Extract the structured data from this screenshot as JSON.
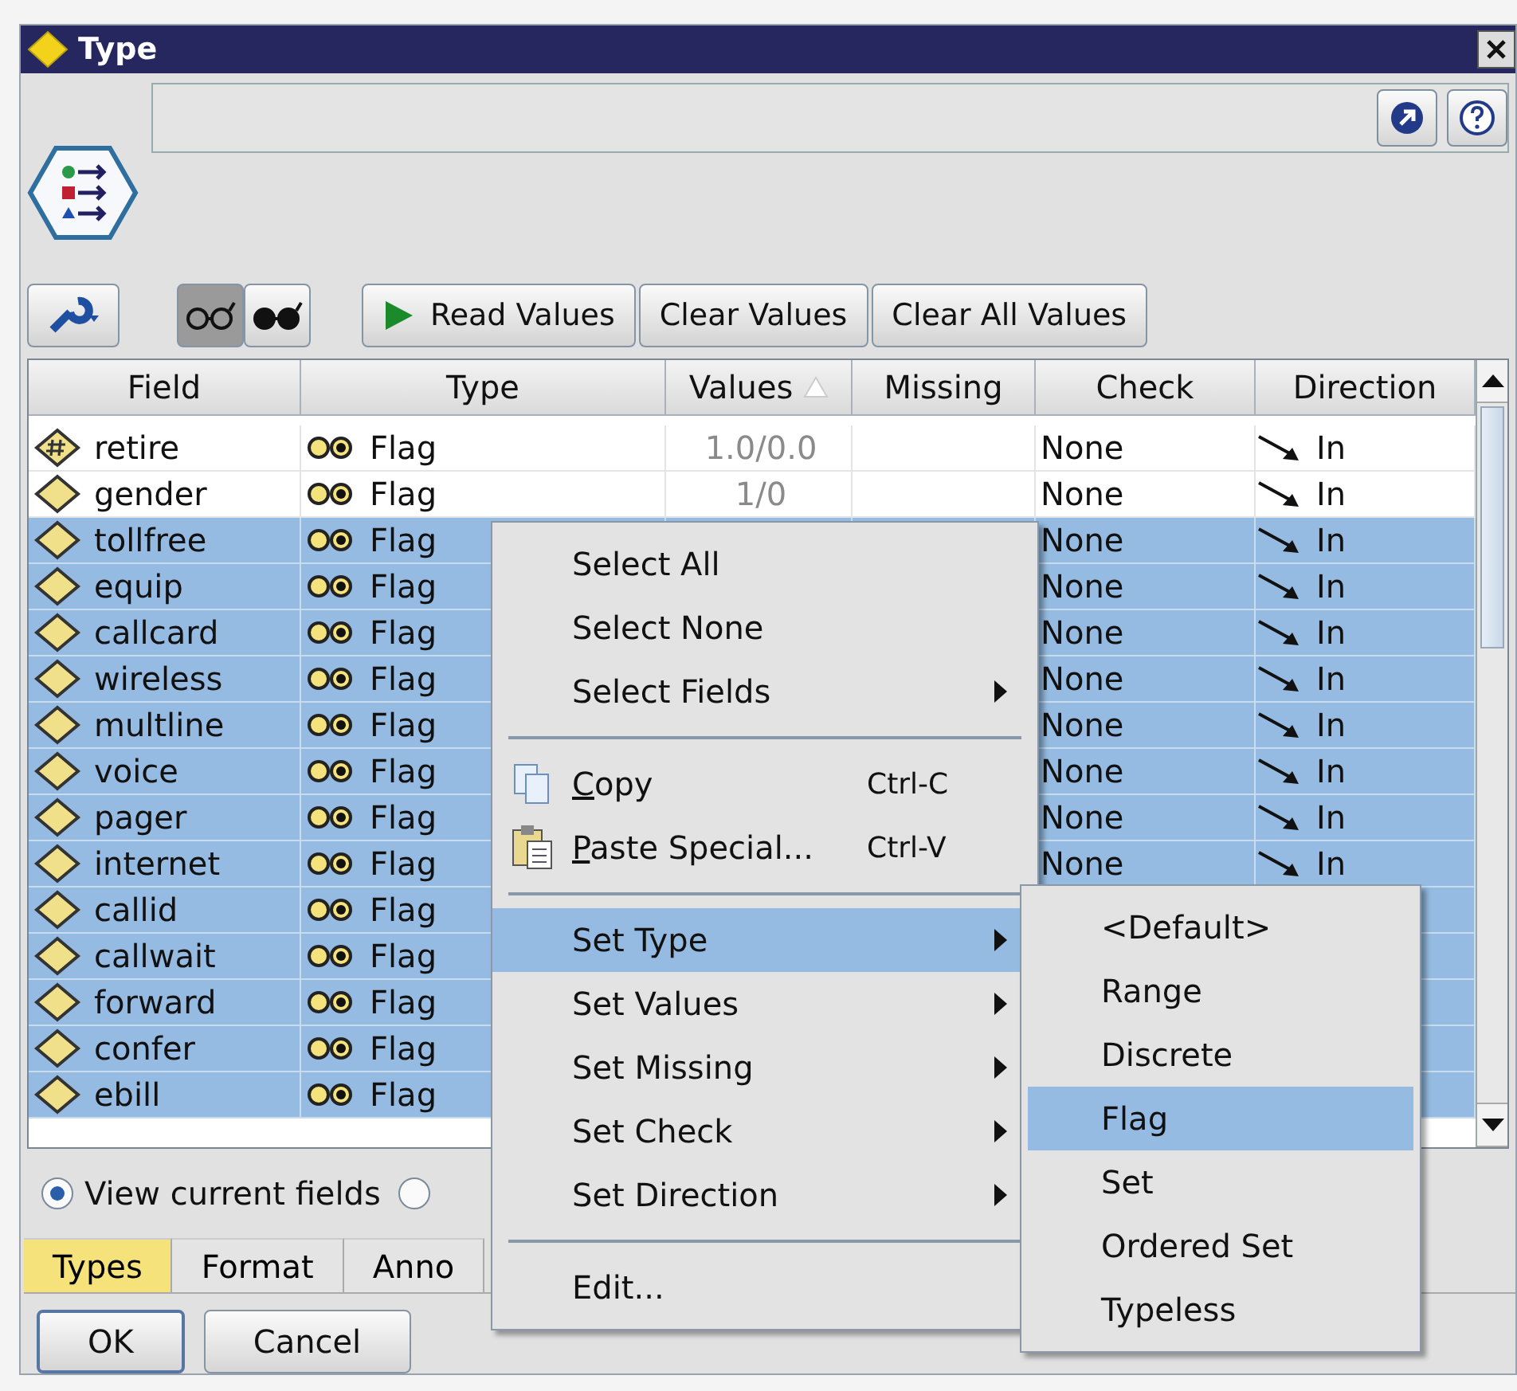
{
  "window": {
    "title": "Type"
  },
  "toolbar": {
    "view_toggles": [
      {
        "selected": true
      },
      {
        "selected": false
      }
    ],
    "buttons": [
      {
        "label": "Read Values",
        "kind": "play"
      },
      {
        "label": "Clear Values",
        "kind": "plain"
      },
      {
        "label": "Clear All Values",
        "kind": "plain"
      }
    ]
  },
  "table": {
    "columns": [
      {
        "label": "Field",
        "sorted": false
      },
      {
        "label": "Type",
        "sorted": false
      },
      {
        "label": "Values",
        "sorted": true
      },
      {
        "label": "Missing",
        "sorted": false
      },
      {
        "label": "Check",
        "sorted": false
      },
      {
        "label": "Direction",
        "sorted": false
      }
    ],
    "rows": [
      {
        "field": "retire",
        "kind": "numeric",
        "type": "Flag",
        "values": "1.0/0.0",
        "check": "None",
        "direction": "In",
        "selected": false
      },
      {
        "field": "gender",
        "kind": "text",
        "type": "Flag",
        "values": "1/0",
        "check": "None",
        "direction": "In",
        "selected": false
      },
      {
        "field": "tollfree",
        "kind": "text",
        "type": "Flag",
        "check": "None",
        "direction": "In",
        "selected": true
      },
      {
        "field": "equip",
        "kind": "text",
        "type": "Flag",
        "check": "None",
        "direction": "In",
        "selected": true
      },
      {
        "field": "callcard",
        "kind": "text",
        "type": "Flag",
        "check": "None",
        "direction": "In",
        "selected": true
      },
      {
        "field": "wireless",
        "kind": "text",
        "type": "Flag",
        "check": "None",
        "direction": "In",
        "selected": true
      },
      {
        "field": "multline",
        "kind": "text",
        "type": "Flag",
        "check": "None",
        "direction": "In",
        "selected": true
      },
      {
        "field": "voice",
        "kind": "text",
        "type": "Flag",
        "check": "None",
        "direction": "In",
        "selected": true
      },
      {
        "field": "pager",
        "kind": "text",
        "type": "Flag",
        "check": "None",
        "direction": "In",
        "selected": true
      },
      {
        "field": "internet",
        "kind": "text",
        "type": "Flag",
        "check": "None",
        "direction": "In",
        "selected": true
      },
      {
        "field": "callid",
        "kind": "text",
        "type": "Flag",
        "selected": true
      },
      {
        "field": "callwait",
        "kind": "text",
        "type": "Flag",
        "selected": true
      },
      {
        "field": "forward",
        "kind": "text",
        "type": "Flag",
        "selected": true
      },
      {
        "field": "confer",
        "kind": "text",
        "type": "Flag",
        "selected": true
      },
      {
        "field": "ebill",
        "kind": "text",
        "type": "Flag",
        "selected": true
      }
    ]
  },
  "radios": [
    {
      "label": "View current fields",
      "selected": true
    },
    {
      "selected": false
    }
  ],
  "tabs": [
    {
      "label": "Types",
      "selected": true
    },
    {
      "label": "Format",
      "selected": false
    },
    {
      "label": "Anno",
      "selected": false
    }
  ],
  "buttons": [
    {
      "label": "OK",
      "default": true
    },
    {
      "label": "Cancel",
      "default": false
    }
  ],
  "context_menu": [
    {
      "kind": "item",
      "label": "Select All",
      "submenu": false,
      "selected": false
    },
    {
      "kind": "item",
      "label": "Select None",
      "submenu": false,
      "selected": false
    },
    {
      "kind": "item",
      "label": "Select Fields",
      "submenu": true,
      "selected": false
    },
    {
      "kind": "separator"
    },
    {
      "kind": "copy",
      "label": "Copy",
      "shortcut": "Ctrl-C",
      "submenu": false,
      "selected": false
    },
    {
      "kind": "paste",
      "label": "Paste Special...",
      "shortcut": "Ctrl-V",
      "submenu": false,
      "selected": false
    },
    {
      "kind": "separator"
    },
    {
      "kind": "item",
      "label": "Set Type",
      "submenu": true,
      "selected": true
    },
    {
      "kind": "item",
      "label": "Set Values",
      "submenu": true,
      "selected": false
    },
    {
      "kind": "item",
      "label": "Set Missing",
      "submenu": true,
      "selected": false
    },
    {
      "kind": "item",
      "label": "Set Check",
      "submenu": true,
      "selected": false
    },
    {
      "kind": "item",
      "label": "Set Direction",
      "submenu": true,
      "selected": false
    },
    {
      "kind": "separator"
    },
    {
      "kind": "item",
      "label": "Edit...",
      "submenu": false,
      "selected": false
    }
  ],
  "submenu": [
    {
      "label": "<Default>",
      "selected": false
    },
    {
      "label": "Range",
      "selected": false
    },
    {
      "label": "Discrete",
      "selected": false
    },
    {
      "label": "Flag",
      "selected": true
    },
    {
      "label": "Set",
      "selected": false
    },
    {
      "label": "Ordered Set",
      "selected": false
    },
    {
      "label": "Typeless",
      "selected": false
    }
  ]
}
